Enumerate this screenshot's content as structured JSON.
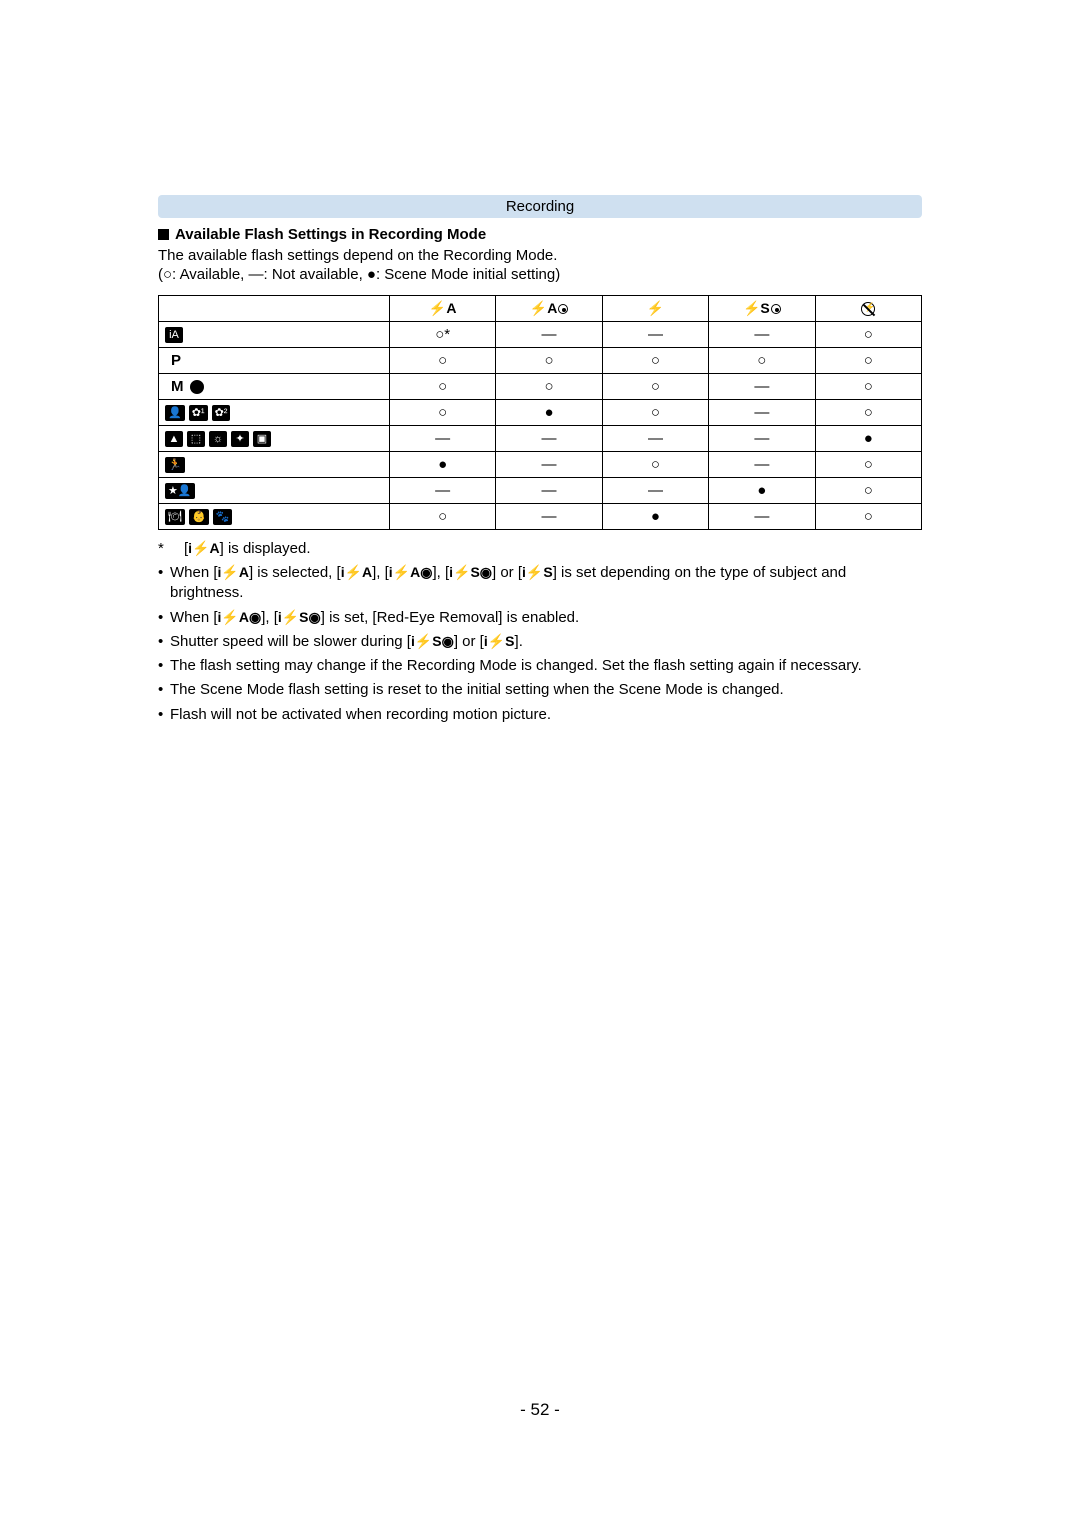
{
  "header": {
    "label": "Recording"
  },
  "section": {
    "title": "Available Flash Settings in Recording Mode",
    "intro": "The available flash settings depend on the Recording Mode.",
    "legend_prefix": "(",
    "legend_a": "○: Available, ",
    "legend_b": "—: Not available, ",
    "legend_c": "●: Scene Mode initial setting)",
    "legend_suffix": ""
  },
  "chart_data": {
    "type": "table",
    "columns": [
      "mode",
      "auto",
      "auto_redeye",
      "forced_on",
      "slow_sync_redeye",
      "forced_off"
    ],
    "column_glyphs": [
      "",
      "⚡A",
      "⚡A◉",
      "⚡",
      "⚡S◉",
      "⊘⚡"
    ],
    "legend": {
      "○": "Available",
      "—": "Not available",
      "●": "Scene Mode initial setting"
    },
    "rows": [
      {
        "mode": "intelligent_auto",
        "auto": "○*",
        "auto_redeye": "—",
        "forced_on": "—",
        "slow_sync_redeye": "—",
        "forced_off": "○"
      },
      {
        "mode": "P",
        "auto": "○",
        "auto_redeye": "○",
        "forced_on": "○",
        "slow_sync_redeye": "○",
        "forced_off": "○"
      },
      {
        "mode": "M_and_creative",
        "auto": "○",
        "auto_redeye": "○",
        "forced_on": "○",
        "slow_sync_redeye": "—",
        "forced_off": "○"
      },
      {
        "mode": "portrait_group",
        "auto": "○",
        "auto_redeye": "●",
        "forced_on": "○",
        "slow_sync_redeye": "—",
        "forced_off": "○"
      },
      {
        "mode": "scenery_group",
        "auto": "—",
        "auto_redeye": "—",
        "forced_on": "—",
        "slow_sync_redeye": "—",
        "forced_off": "●"
      },
      {
        "mode": "sports",
        "auto": "●",
        "auto_redeye": "—",
        "forced_on": "○",
        "slow_sync_redeye": "—",
        "forced_off": "○"
      },
      {
        "mode": "night_portrait",
        "auto": "—",
        "auto_redeye": "—",
        "forced_on": "—",
        "slow_sync_redeye": "●",
        "forced_off": "○"
      },
      {
        "mode": "misc_group",
        "auto": "○",
        "auto_redeye": "—",
        "forced_on": "●",
        "slow_sync_redeye": "—",
        "forced_off": "○"
      }
    ]
  },
  "table_rows": {
    "r0": {
      "c1": "○*",
      "c2": "—",
      "c3": "—",
      "c4": "—",
      "c5": "○"
    },
    "r1": {
      "label": "P",
      "c1": "○",
      "c2": "○",
      "c3": "○",
      "c4": "○",
      "c5": "○"
    },
    "r2": {
      "label": "M",
      "c1": "○",
      "c2": "○",
      "c3": "○",
      "c4": "—",
      "c5": "○"
    },
    "r3": {
      "c1": "○",
      "c2": "●",
      "c3": "○",
      "c4": "—",
      "c5": "○"
    },
    "r4": {
      "c1": "—",
      "c2": "—",
      "c3": "—",
      "c4": "—",
      "c5": "●"
    },
    "r5": {
      "c1": "●",
      "c2": "—",
      "c3": "○",
      "c4": "—",
      "c5": "○"
    },
    "r6": {
      "c1": "—",
      "c2": "—",
      "c3": "—",
      "c4": "●",
      "c5": "○"
    },
    "r7": {
      "c1": "○",
      "c2": "—",
      "c3": "●",
      "c4": "—",
      "c5": "○"
    }
  },
  "footnote": {
    "mark": "*",
    "text_before": "[",
    "sym": "i⚡A",
    "text_after": "] is displayed."
  },
  "notes": {
    "n1a": "When [",
    "n1s1": "i⚡A",
    "n1b": "] is selected, [",
    "n1s2": "i⚡A",
    "n1c": "], [",
    "n1s3": "i⚡A◉",
    "n1d": "], [",
    "n1s4": "i⚡S◉",
    "n1e": "] or [",
    "n1s5": "i⚡S",
    "n1f": "] is set depending on the type of subject and brightness.",
    "n2a": "When [",
    "n2s1": "i⚡A◉",
    "n2b": "], [",
    "n2s2": "i⚡S◉",
    "n2c": "] is set, [Red-Eye Removal] is enabled.",
    "n3a": "Shutter speed will be slower during [",
    "n3s1": "i⚡S◉",
    "n3b": "] or [",
    "n3s2": "i⚡S",
    "n3c": "].",
    "n4": "The flash setting may change if the Recording Mode is changed. Set the flash setting again if necessary.",
    "n5": "The Scene Mode flash setting is reset to the initial setting when the Scene Mode is changed.",
    "n6": "Flash will not be activated when recording motion picture."
  },
  "page_number": "- 52 -",
  "col_header": {
    "c1": "⚡A",
    "c3": "⚡",
    "c4p": "⚡S"
  }
}
